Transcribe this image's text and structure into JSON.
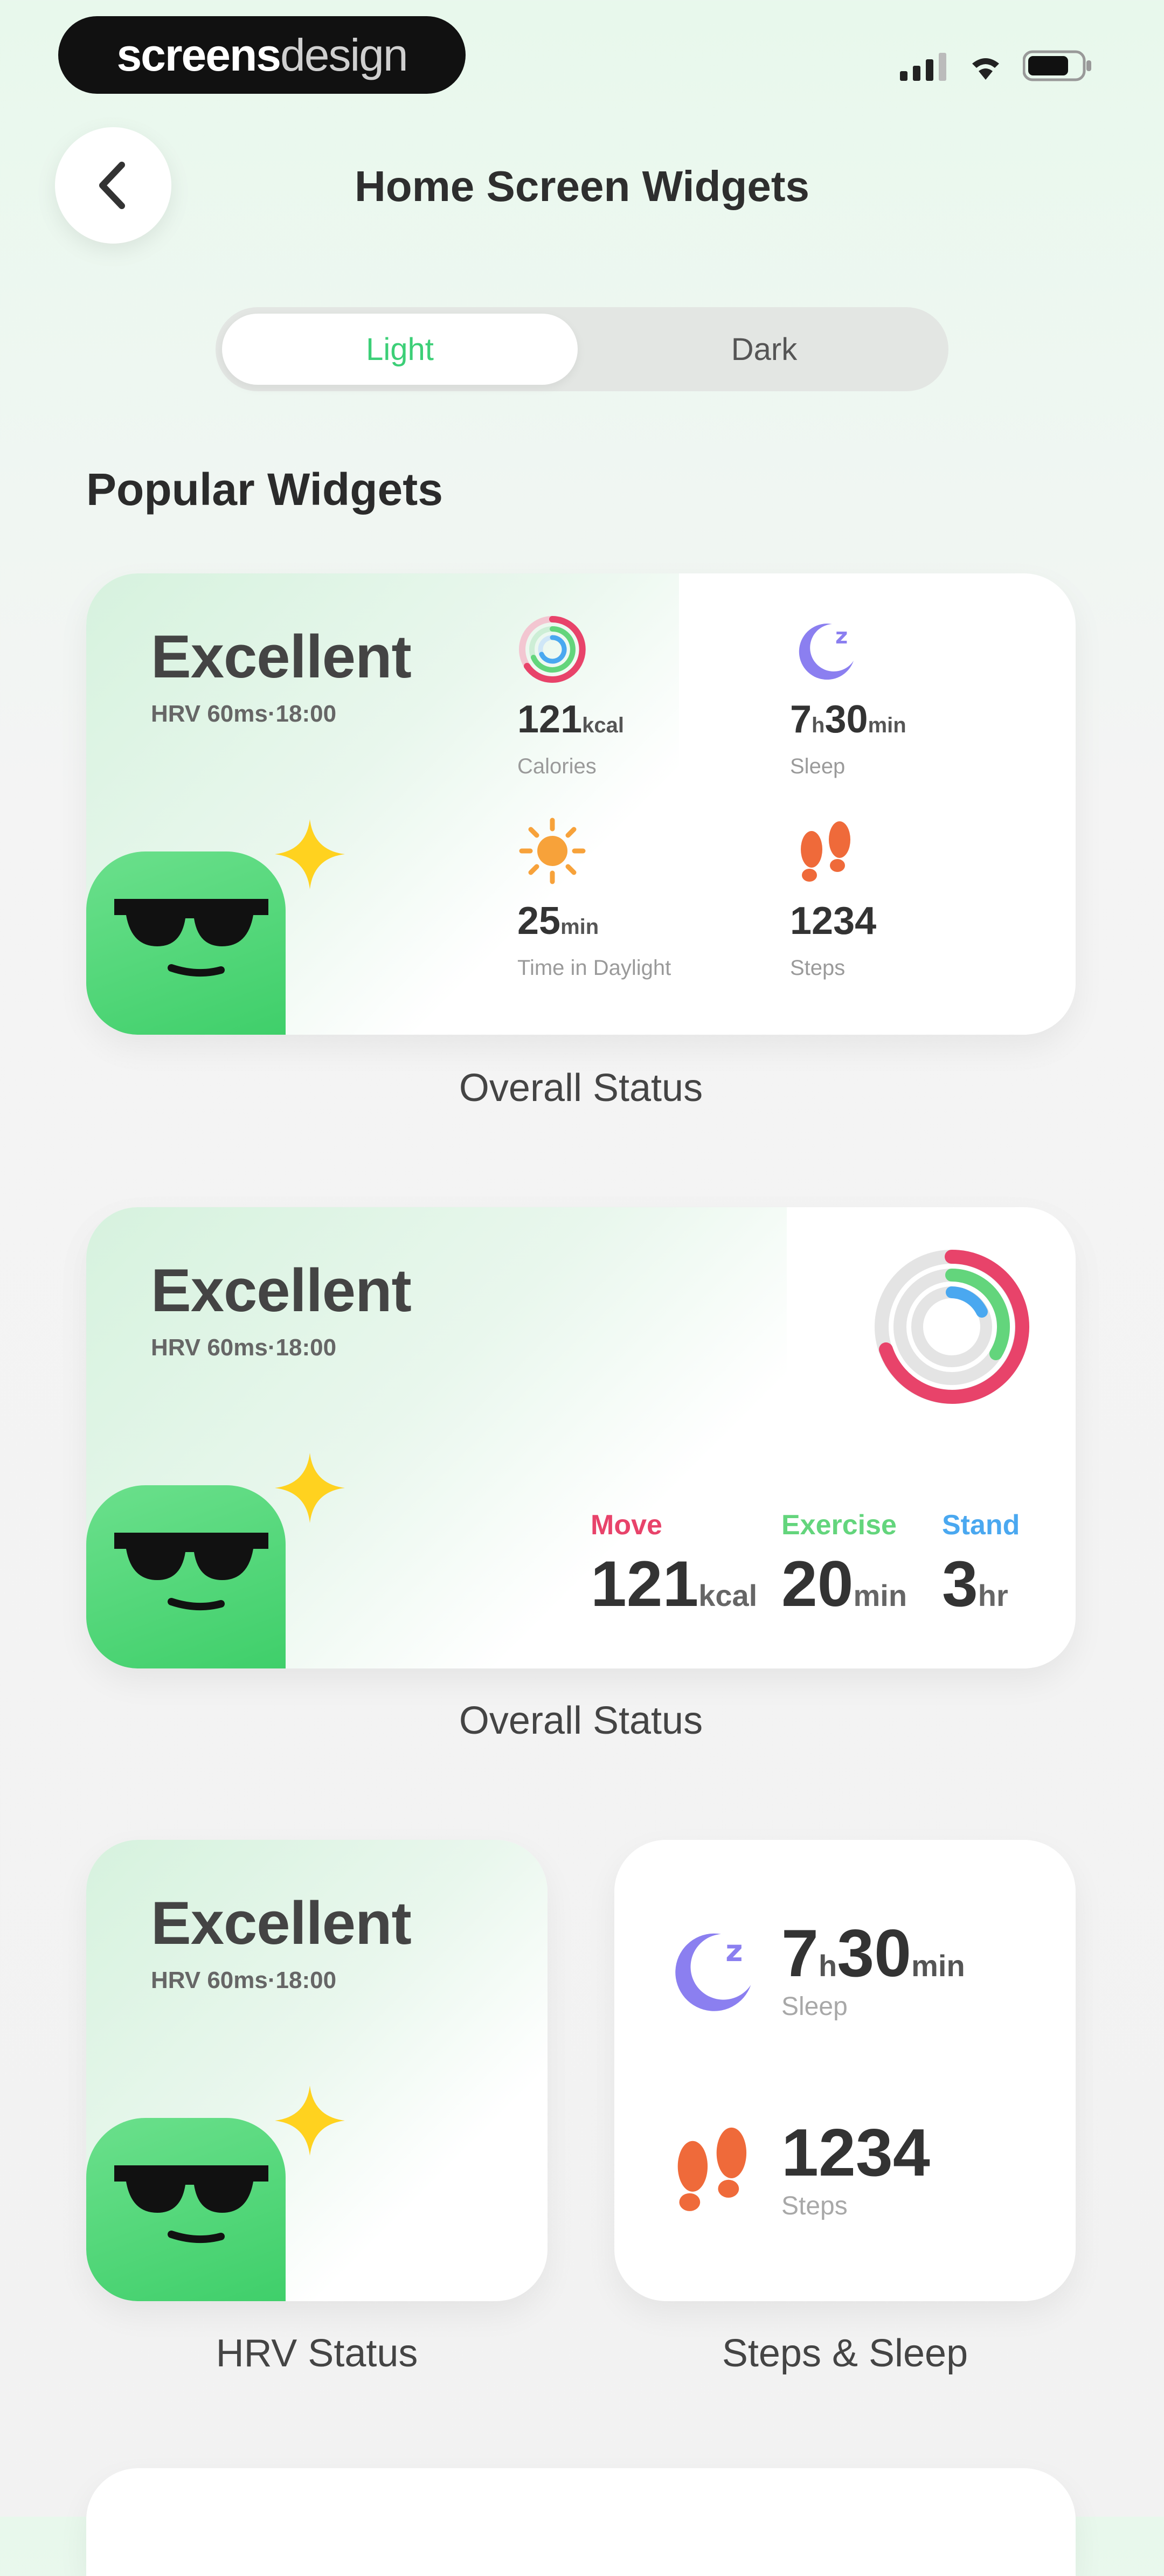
{
  "status_bar": {
    "brand_bold": "screens",
    "brand_light": "design",
    "icons": [
      "cellular-signal-icon",
      "wifi-icon",
      "battery-icon"
    ]
  },
  "header": {
    "back_icon": "chevron-left-icon",
    "title": "Home Screen Widgets"
  },
  "theme_toggle": {
    "options": [
      "Light",
      "Dark"
    ],
    "selected": "Light",
    "accent": "#3ccf77"
  },
  "section_title": "Popular Widgets",
  "widgets": [
    {
      "status": "Excellent",
      "hrv": "HRV 60ms·18:00",
      "metrics": [
        {
          "icon": "activity-rings-icon",
          "value": "121",
          "unit": "kcal",
          "label": "Calories"
        },
        {
          "icon": "moon-icon",
          "value_a": "7",
          "unit_a": "h",
          "value_b": "30",
          "unit_b": "min",
          "label": "Sleep"
        },
        {
          "icon": "sun-icon",
          "value": "25",
          "unit": "min",
          "label": "Time in Daylight"
        },
        {
          "icon": "footprints-icon",
          "value": "1234",
          "label": "Steps"
        }
      ],
      "caption": "Overall Status"
    },
    {
      "status": "Excellent",
      "hrv": "HRV 60ms·18:00",
      "rings_icon": "activity-rings-icon",
      "move": {
        "label": "Move",
        "value": "121",
        "unit": "kcal",
        "color": "#e8436a"
      },
      "exercise": {
        "label": "Exercise",
        "value": "20",
        "unit": "min",
        "color": "#63d57c"
      },
      "stand": {
        "label": "Stand",
        "value": "3",
        "unit": "hr",
        "color": "#4aa8f0"
      },
      "caption": "Overall Status"
    },
    {
      "status": "Excellent",
      "hrv": "HRV 60ms·18:00",
      "caption": "HRV Status"
    },
    {
      "sleep": {
        "icon": "moon-icon",
        "value_a": "7",
        "unit_a": "h",
        "value_b": "30",
        "unit_b": "min",
        "label": "Sleep"
      },
      "steps": {
        "icon": "footprints-icon",
        "value": "1234",
        "label": "Steps"
      },
      "caption": "Steps & Sleep"
    }
  ],
  "colors": {
    "mascot_green": "#4fd877",
    "sparkle_yellow": "#ffd21f",
    "moon_purple": "#8b7ff0",
    "footprint_orange": "#ef6a3a",
    "sun_orange": "#f7a23a"
  }
}
